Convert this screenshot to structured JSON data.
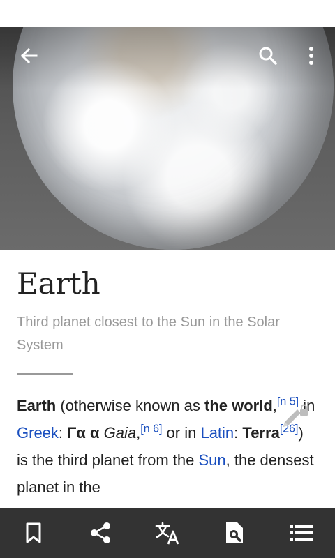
{
  "article": {
    "title": "Earth",
    "description": "Third planet closest to the Sun in the Solar System",
    "paragraph": {
      "t_earth": "Earth",
      "t1": " (otherwise known as ",
      "t_world": "the world",
      "t2": ",",
      "ref1": "[n 5]",
      "t3": " in ",
      "link_greek": "Greek",
      "t4": ": ",
      "greek_word": "Γα α",
      "t5": " ",
      "gaia": "Gaia",
      "t6": ",",
      "ref2": "[n 6]",
      "t7": " or in ",
      "link_latin": "Latin",
      "t8": ": ",
      "terra": "Terra",
      "ref3": "[26]",
      "t9": ") is the third planet from the ",
      "link_sun": "Sun",
      "t10": ", the densest planet in the"
    }
  },
  "toolbar": {
    "icons": [
      "back-arrow-icon",
      "search-icon",
      "more-vert-icon"
    ]
  },
  "bottom_bar": {
    "icons": [
      "bookmark-icon",
      "share-icon",
      "translate-icon",
      "find-in-page-icon",
      "contents-icon"
    ]
  },
  "colors": {
    "link": "#1a4fbf",
    "bottom_bar": "#333333",
    "subtitle": "#999999"
  }
}
